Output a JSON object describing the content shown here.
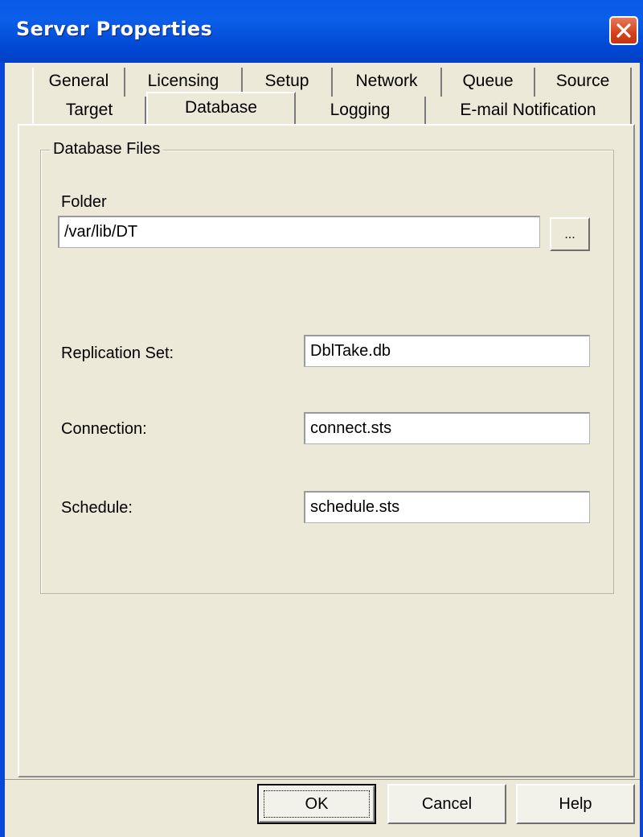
{
  "window": {
    "title": "Server Properties",
    "close_icon": "close-icon"
  },
  "tabs": {
    "row1": [
      "General",
      "Licensing",
      "Setup",
      "Network",
      "Queue",
      "Source"
    ],
    "row2": [
      "Target",
      "Database",
      "Logging",
      "E-mail Notification"
    ],
    "selected": "Database"
  },
  "group": {
    "label": "Database Files",
    "folder_label": "Folder",
    "folder_value": "/var/lib/DT",
    "browse_label": "...",
    "replication_label": "Replication Set:",
    "replication_value": "DblTake.db",
    "connection_label": "Connection:",
    "connection_value": "connect.sts",
    "schedule_label": "Schedule:",
    "schedule_value": "schedule.sts"
  },
  "buttons": {
    "ok": "OK",
    "cancel": "Cancel",
    "help": "Help"
  },
  "colors": {
    "titlebar": "#0a5ae8",
    "face": "#ece9d8",
    "close": "#d3421c"
  }
}
